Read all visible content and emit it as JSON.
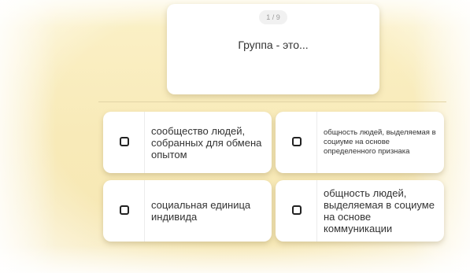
{
  "question": {
    "counter": "1 / 9",
    "text": "Группа - это..."
  },
  "answers": [
    {
      "label": "сообщество людей, собранных для обмена опытом"
    },
    {
      "label": "общность людей, выделяемая в социуме на основе определенного признака"
    },
    {
      "label": "социальная единица индивида"
    },
    {
      "label": "общность людей, выделяемая в социуме на основе коммуникации"
    }
  ],
  "colors": {
    "background": "#f8eab8",
    "card": "#ffffff",
    "text": "#333333",
    "checkbox_border": "#222222"
  },
  "icons": {
    "checkbox": "checkbox-icon"
  }
}
